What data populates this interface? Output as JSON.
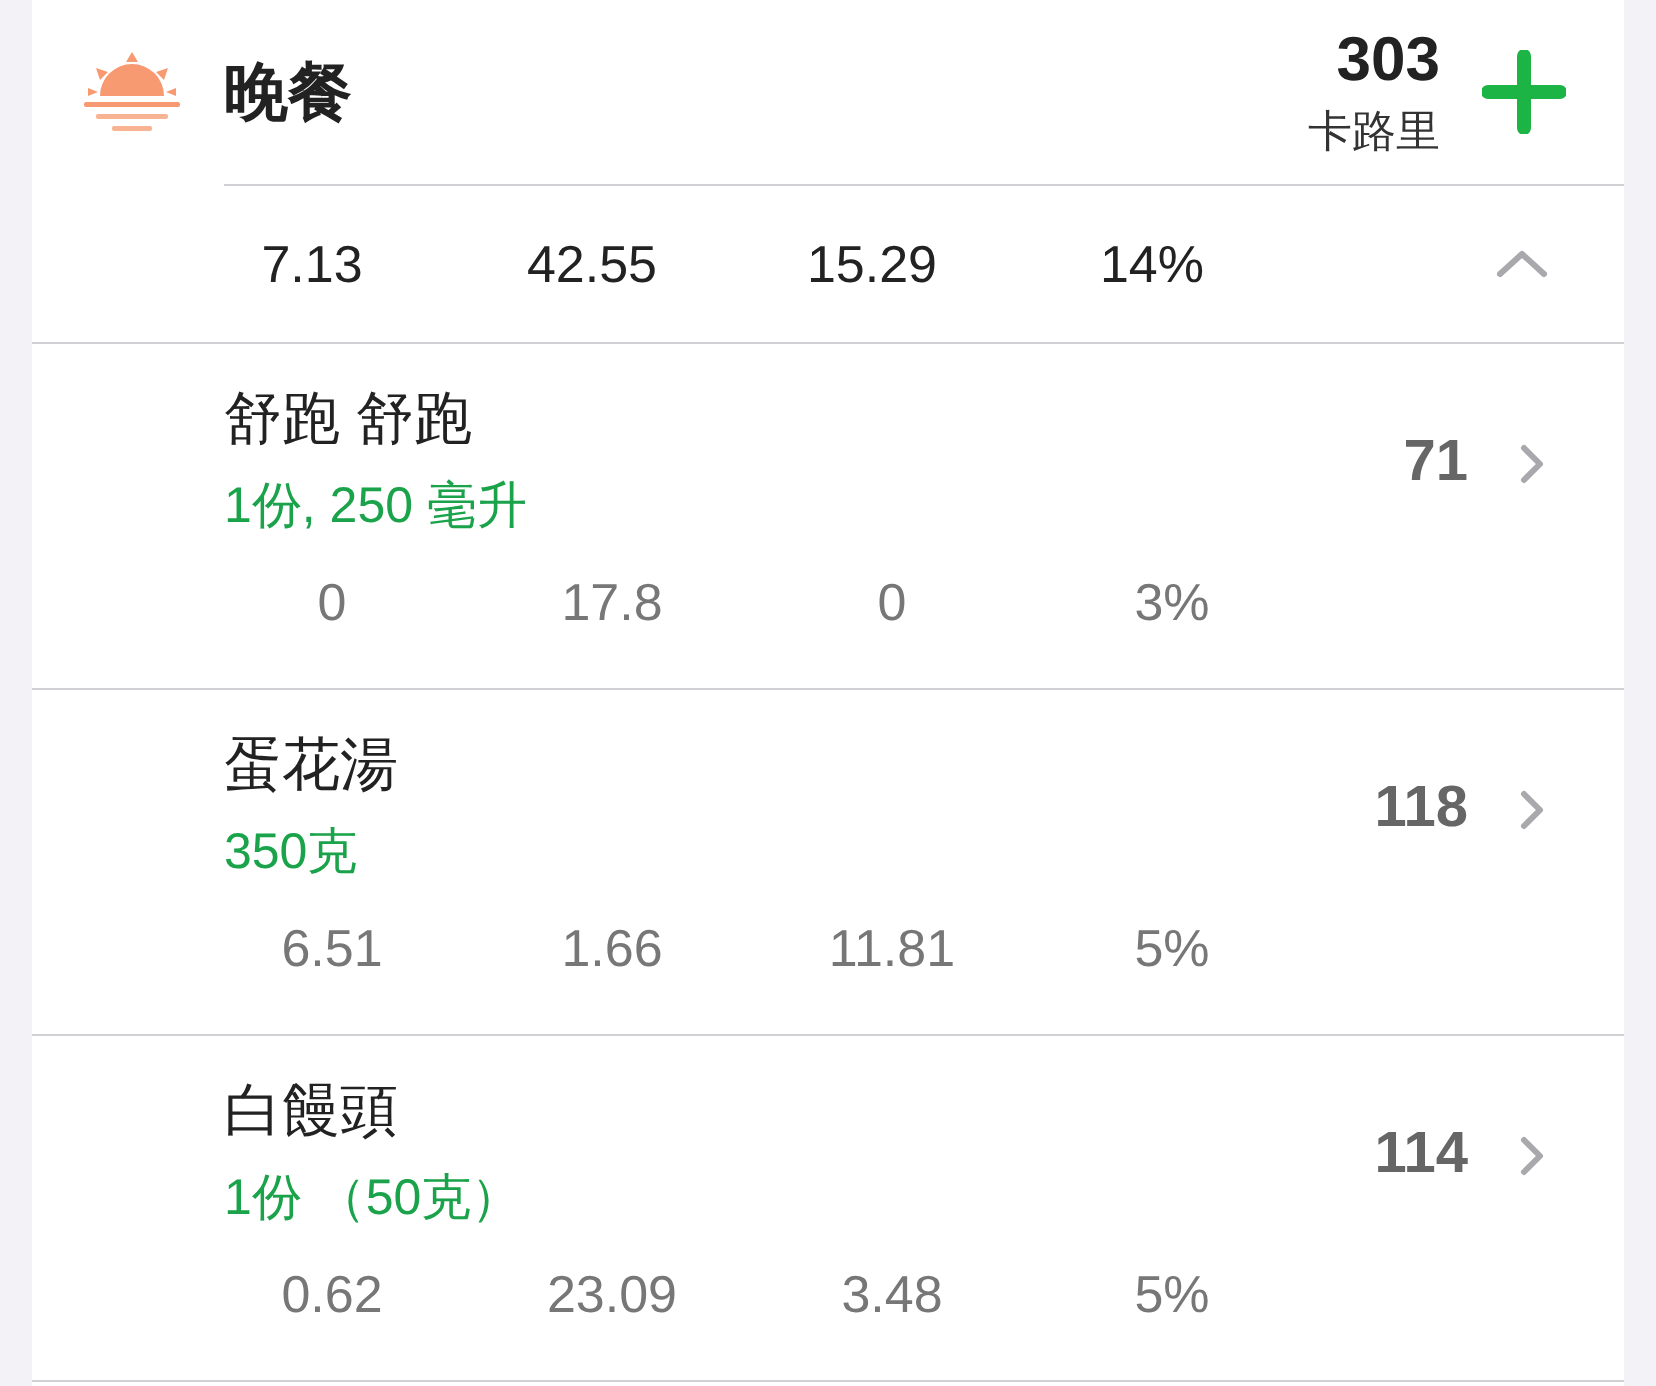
{
  "meal": {
    "title": "晚餐",
    "calories": "303",
    "calories_unit": "卡路里",
    "expanded": true,
    "totals": [
      "7.13",
      "42.55",
      "15.29",
      "14%"
    ]
  },
  "items": [
    {
      "name": "舒跑 舒跑",
      "portion": "1份, 250 毫升",
      "calories": "71",
      "nutrients": [
        "0",
        "17.8",
        "0",
        "3%"
      ]
    },
    {
      "name": "蛋花湯",
      "portion": "350克",
      "calories": "118",
      "nutrients": [
        "6.51",
        "1.66",
        "11.81",
        "5%"
      ]
    },
    {
      "name": "白饅頭",
      "portion": "1份 （50克）",
      "calories": "114",
      "nutrients": [
        "0.62",
        "23.09",
        "3.48",
        "5%"
      ]
    }
  ]
}
